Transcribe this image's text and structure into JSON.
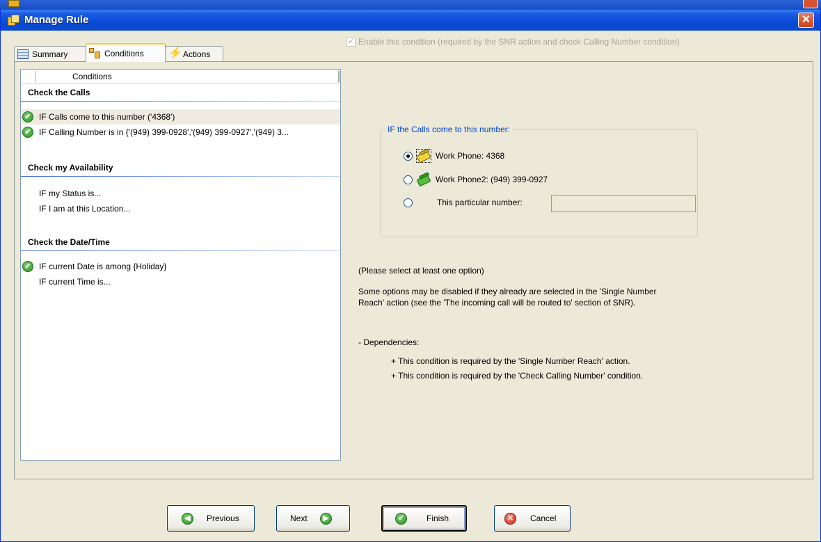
{
  "window": {
    "title": "Manage Rule",
    "close_label": "✕"
  },
  "tabs": [
    {
      "label": "Summary",
      "active": false
    },
    {
      "label": "Conditions",
      "active": true
    },
    {
      "label": "Actions",
      "active": false
    }
  ],
  "conditions_list": {
    "column_header": "Conditions",
    "groups": [
      {
        "title": "Check the Calls",
        "items": [
          {
            "label": "IF Calls come to this number ('4368')",
            "checked": true,
            "selected": true
          },
          {
            "label": "IF Calling Number is in {'(949) 399-0928','(949) 399-0927','(949) 3...",
            "checked": true,
            "selected": false
          }
        ]
      },
      {
        "title": "Check my Availability",
        "items": [
          {
            "label": "IF my Status is...",
            "checked": false,
            "selected": false
          },
          {
            "label": "IF I am at this Location...",
            "checked": false,
            "selected": false
          }
        ]
      },
      {
        "title": "Check the Date/Time",
        "items": [
          {
            "label": "IF current Date is among {Holiday}",
            "checked": true,
            "selected": false
          },
          {
            "label": "IF current Time is...",
            "checked": false,
            "selected": false
          }
        ]
      }
    ]
  },
  "detail": {
    "enable_label": "Enable this condition (required by the SNR action and check Calling Number condition)",
    "enable_checked": true,
    "group_legend": "IF the Calls come to this number:",
    "options": [
      {
        "label": "Work Phone: 4368",
        "selected": true
      },
      {
        "label": "Work Phone2: (949) 399-0927",
        "selected": false
      },
      {
        "label": "This particular number:",
        "selected": false
      }
    ],
    "particular_number_value": "",
    "note_select": "(Please select at least one option)",
    "note_disabled_1": "Some options may be disabled if they already are selected in the 'Single Number",
    "note_disabled_2": "Reach' action (see the 'The incoming call will be routed to' section of SNR).",
    "dependencies_title": "- Dependencies:",
    "dependencies": [
      "+ This condition is required by the 'Single Number Reach' action.",
      "+ This condition is required by the 'Check Calling Number' condition."
    ]
  },
  "buttons": {
    "previous": "Previous",
    "next": "Next",
    "finish": "Finish",
    "cancel": "Cancel"
  },
  "icons": {
    "check_mark": "✔",
    "arrow_left": "◀",
    "arrow_right": "▶",
    "cancel_x": "✕"
  }
}
